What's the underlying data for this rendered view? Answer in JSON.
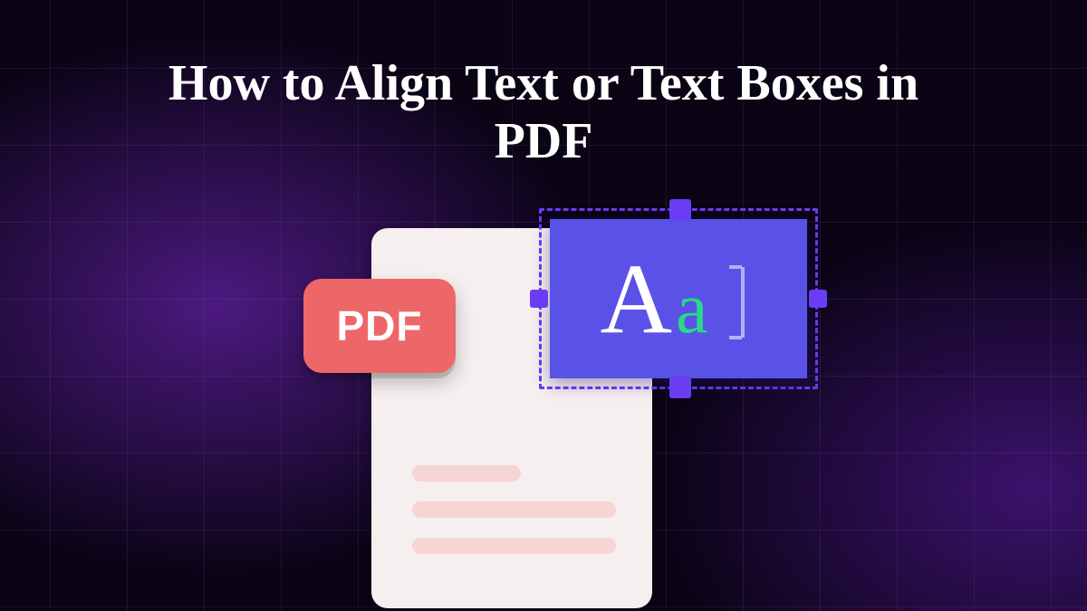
{
  "title": "How to Align Text or Text Boxes in PDF",
  "illustration": {
    "badge_label": "PDF",
    "sample_upper": "A",
    "sample_lower": "a",
    "colors": {
      "badge": "#ed6768",
      "selection_handle": "#6a3df5",
      "text_panel": "#5a52e6",
      "accent_letter": "#29d98a",
      "document_bg": "#f6efef",
      "document_line": "#f6d5d4"
    }
  }
}
